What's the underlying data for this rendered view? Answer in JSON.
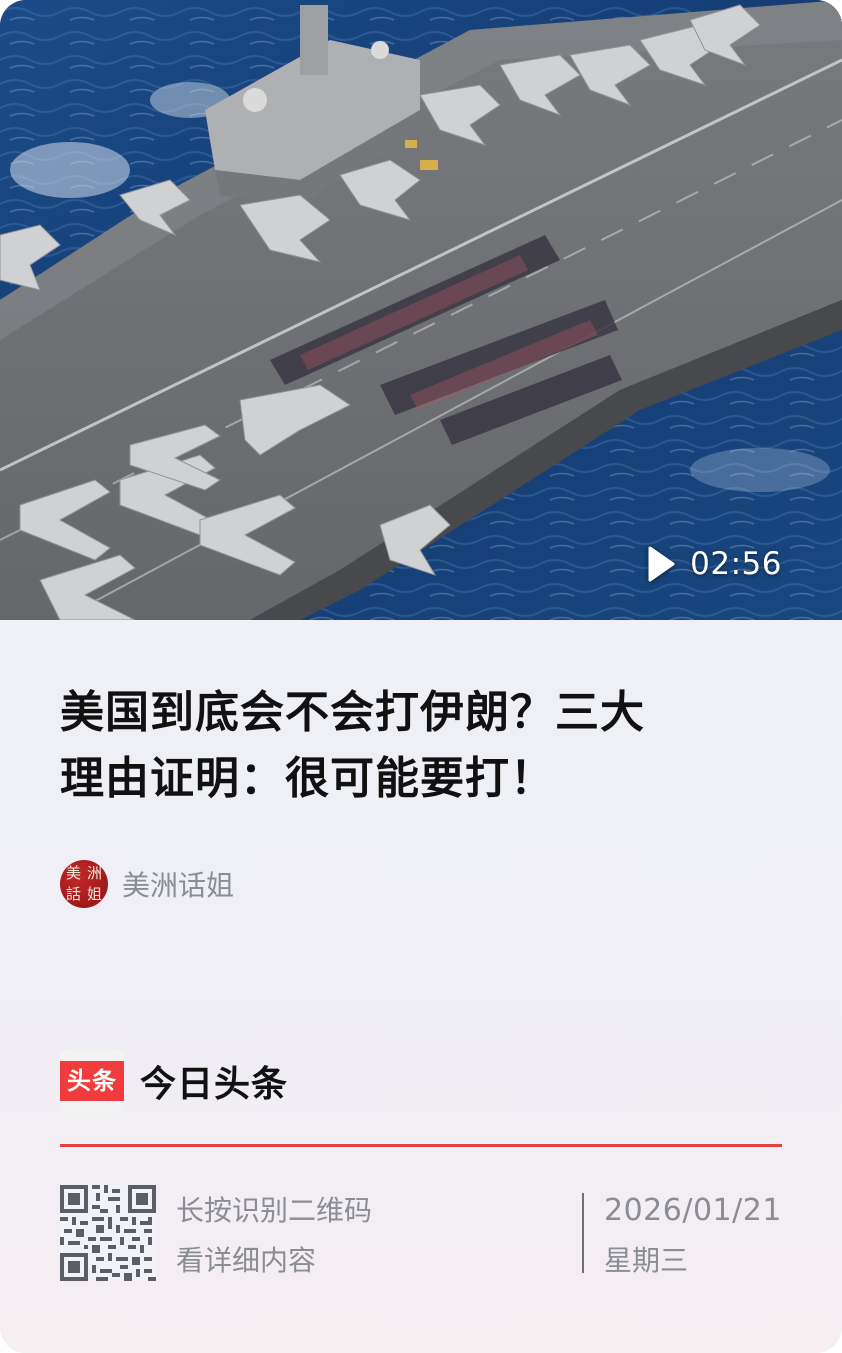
{
  "video": {
    "duration": "02:56",
    "thumbnail_icon": "aircraft-carrier-photo",
    "play_icon": "play-icon"
  },
  "article": {
    "title_line1": "美国到底会不会打伊朗？三大",
    "title_line2": "理由证明：很可能要打！"
  },
  "author": {
    "name": "美洲话姐",
    "avatar_chars": [
      "美",
      "洲",
      "話",
      "姐"
    ]
  },
  "brand": {
    "logo_text": "头条",
    "name": "今日头条",
    "accent_color": "#e2413e"
  },
  "footer": {
    "qr_line1": "长按识别二维码",
    "qr_line2": "看详细内容",
    "date": "2026/01/21",
    "weekday": "星期三"
  }
}
